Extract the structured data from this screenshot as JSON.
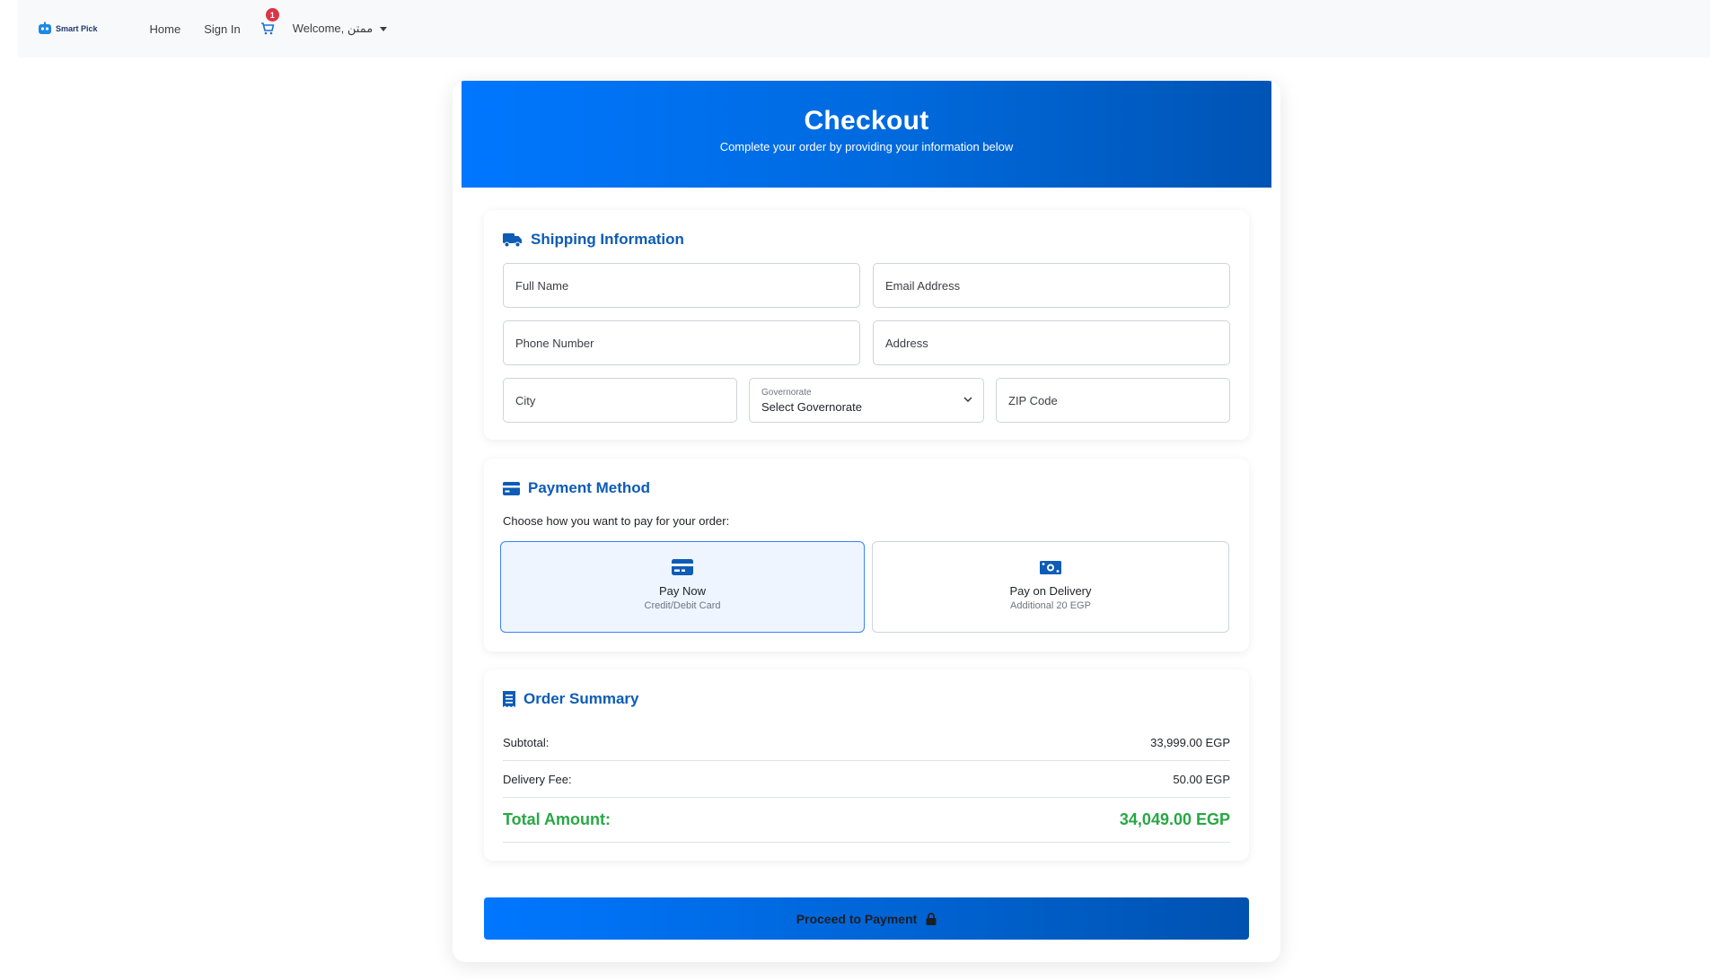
{
  "nav": {
    "brand": "Smart Pick",
    "links": {
      "home": "Home",
      "signin": "Sign In"
    },
    "cart_count": "1",
    "welcome": "Welcome, ممتن"
  },
  "checkout": {
    "title": "Checkout",
    "subtitle": "Complete your order by providing your information below"
  },
  "shipping": {
    "title": "Shipping Information",
    "full_name_placeholder": "Full Name",
    "email_placeholder": "Email Address",
    "phone_placeholder": "Phone Number",
    "address_placeholder": "Address",
    "city_placeholder": "City",
    "governorate_label": "Governorate",
    "governorate_value": "Select Governorate",
    "zip_placeholder": "ZIP Code"
  },
  "payment": {
    "title": "Payment Method",
    "hint": "Choose how you want to pay for your order:",
    "options": [
      {
        "label": "Pay Now",
        "sub": "Credit/Debit Card",
        "selected": true
      },
      {
        "label": "Pay on Delivery",
        "sub": "Additional 20 EGP",
        "selected": false
      }
    ]
  },
  "summary": {
    "title": "Order Summary",
    "subtotal_label": "Subtotal:",
    "subtotal_value": "33,999.00 EGP",
    "delivery_label": "Delivery Fee:",
    "delivery_value": "50.00 EGP",
    "total_label": "Total Amount:",
    "total_value": "34,049.00 EGP"
  },
  "actions": {
    "proceed": "Proceed to Payment"
  },
  "colors": {
    "primary": "#0077ff",
    "heading_blue": "#0d5cb6",
    "success_green": "#28a745",
    "badge_red": "#dc3545"
  }
}
